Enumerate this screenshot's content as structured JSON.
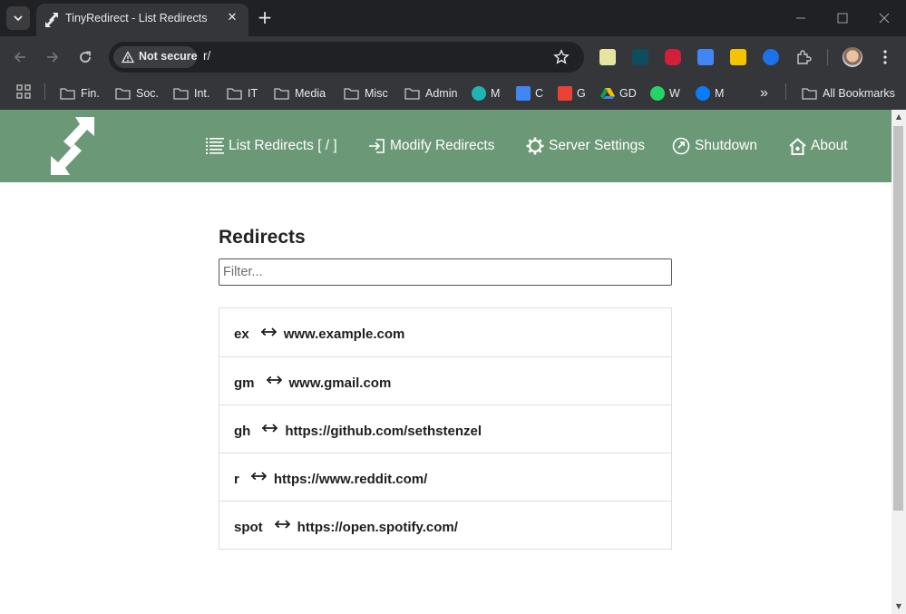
{
  "browser": {
    "tab": {
      "title": "TinyRedirect - List Redirects",
      "close": "✕"
    },
    "new_tab": "+",
    "security_chip": "Not secure",
    "url": "r/",
    "bookmarks": [
      {
        "label": "Fin.",
        "icon": "folder-icon"
      },
      {
        "label": "Soc.",
        "icon": "folder-icon"
      },
      {
        "label": "Int.",
        "icon": "folder-icon"
      },
      {
        "label": "IT",
        "icon": "folder-icon"
      },
      {
        "label": "Media",
        "icon": "folder-icon"
      },
      {
        "label": "Misc",
        "icon": "folder-icon"
      },
      {
        "label": "Admin",
        "icon": "folder-icon"
      },
      {
        "label": "M",
        "icon": "meet-icon"
      },
      {
        "label": "C",
        "icon": "calendar-icon"
      },
      {
        "label": "G",
        "icon": "gmail-icon"
      },
      {
        "label": "GD",
        "icon": "google-drive-icon"
      },
      {
        "label": "W",
        "icon": "whatsapp-icon"
      },
      {
        "label": "M",
        "icon": "messenger-icon"
      }
    ],
    "overflow": "»",
    "all_bookmarks": "All Bookmarks"
  },
  "site": {
    "nav": [
      {
        "label": "List Redirects [ / ]",
        "icon": "list-icon"
      },
      {
        "label": "Modify Redirects",
        "icon": "sign-in-icon"
      },
      {
        "label": "Server Settings",
        "icon": "gear-icon"
      },
      {
        "label": "Shutdown",
        "icon": "power-icon"
      },
      {
        "label": "About",
        "icon": "home-icon"
      }
    ]
  },
  "main": {
    "heading": "Redirects",
    "filter_placeholder": "Filter...",
    "redirects": [
      {
        "key": "ex",
        "target": "www.example.com"
      },
      {
        "key": "gm",
        "target": "www.gmail.com"
      },
      {
        "key": "gh",
        "target": "https://github.com/sethstenzel"
      },
      {
        "key": "r",
        "target": "https://www.reddit.com/"
      },
      {
        "key": "spot",
        "target": "https://open.spotify.com/"
      }
    ]
  },
  "colors": {
    "header_green": "#6b9977",
    "browser_dark": "#202124",
    "browser_toolbar": "#35363a"
  }
}
